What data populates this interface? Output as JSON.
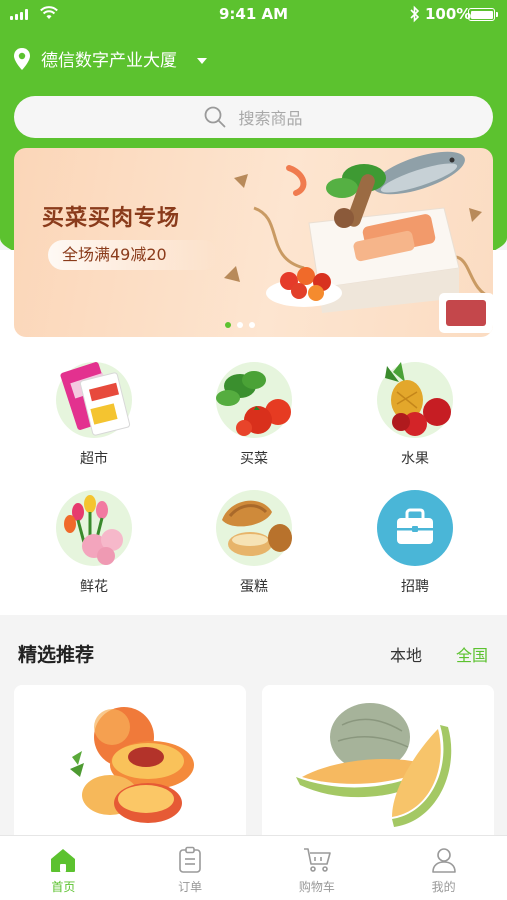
{
  "status_bar": {
    "time": "9:41 AM",
    "battery": "100%"
  },
  "location": {
    "name": "德信数字产业大厦"
  },
  "search": {
    "placeholder": "搜索商品"
  },
  "banner": {
    "title": "买菜买肉专场",
    "subtitle": "全场满49减20",
    "page_count": 3,
    "active_index": 0
  },
  "categories": [
    {
      "label": "超市",
      "icon": "supermarket-icon"
    },
    {
      "label": "买菜",
      "icon": "vegetables-icon"
    },
    {
      "label": "水果",
      "icon": "fruit-icon"
    },
    {
      "label": "鲜花",
      "icon": "flowers-icon"
    },
    {
      "label": "蛋糕",
      "icon": "cake-icon"
    },
    {
      "label": "招聘",
      "icon": "briefcase-icon"
    }
  ],
  "recommend": {
    "title": "精选推荐",
    "tabs": [
      "本地",
      "全国"
    ],
    "active_tab": 1
  },
  "tabbar": [
    {
      "label": "首页",
      "icon": "home-icon",
      "active": true
    },
    {
      "label": "订单",
      "icon": "order-icon",
      "active": false
    },
    {
      "label": "购物车",
      "icon": "cart-icon",
      "active": false
    },
    {
      "label": "我的",
      "icon": "user-icon",
      "active": false
    }
  ],
  "colors": {
    "brand": "#5cc22f",
    "banner_text": "#8a3b1b",
    "recruit_blue": "#4ab6d7"
  }
}
